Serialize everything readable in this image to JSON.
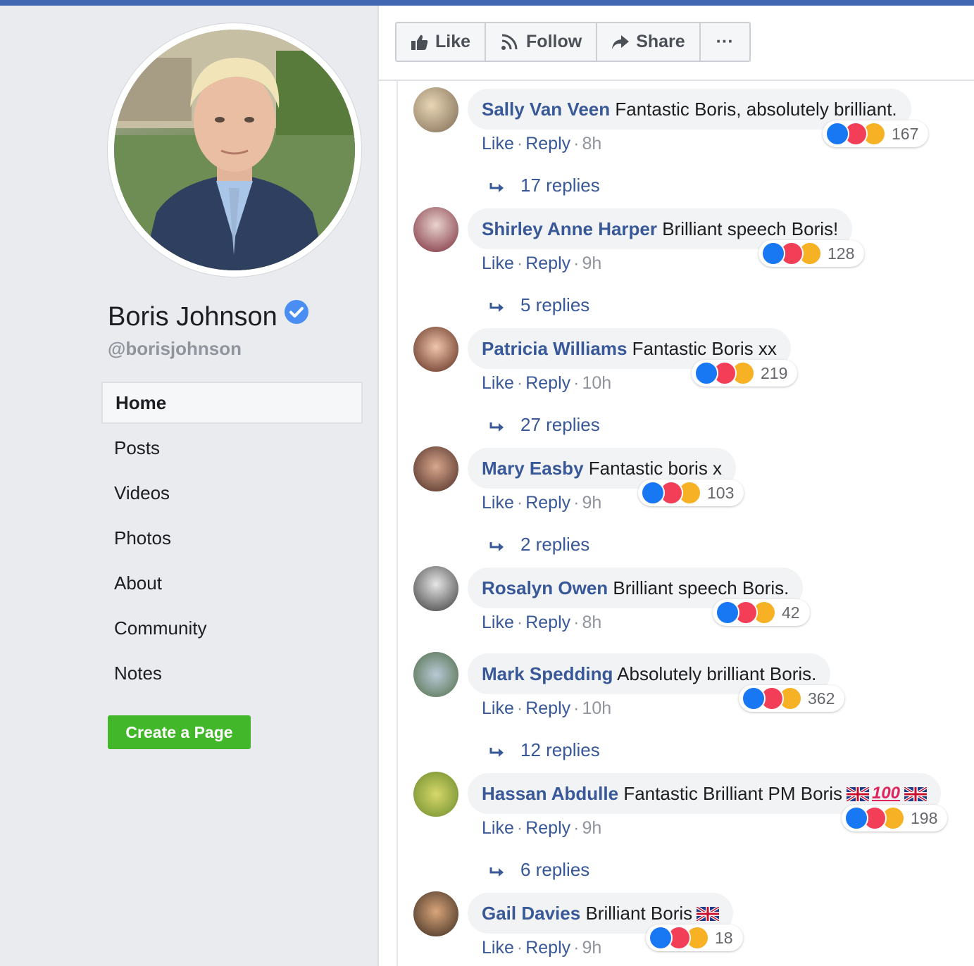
{
  "page": {
    "name": "Boris Johnson",
    "handle": "@borisjohnson"
  },
  "nav": [
    {
      "label": "Home"
    },
    {
      "label": "Posts"
    },
    {
      "label": "Videos"
    },
    {
      "label": "Photos"
    },
    {
      "label": "About"
    },
    {
      "label": "Community"
    },
    {
      "label": "Notes"
    }
  ],
  "create_page_label": "Create a Page",
  "actions": {
    "like": "Like",
    "follow": "Follow",
    "share": "Share",
    "more": "···"
  },
  "comment_labels": {
    "like": "Like",
    "reply": "Reply",
    "separator": "·"
  },
  "comments": [
    {
      "author": "Sally Van Veen",
      "text": "Fantastic Boris, absolutely brilliant.",
      "time": "8h",
      "reactions": "167",
      "replies": "17 replies"
    },
    {
      "author": "Shirley Anne Harper",
      "text": "Brilliant speech Boris!",
      "time": "9h",
      "reactions": "128",
      "replies": "5 replies"
    },
    {
      "author": "Patricia Williams",
      "text": "Fantastic Boris xx",
      "time": "10h",
      "reactions": "219",
      "replies": "27 replies"
    },
    {
      "author": "Mary Easby",
      "text": "Fantastic boris x",
      "time": "9h",
      "reactions": "103",
      "replies": "2 replies"
    },
    {
      "author": "Rosalyn Owen",
      "text": "Brilliant speech Boris.",
      "time": "8h",
      "reactions": "42",
      "replies": ""
    },
    {
      "author": "Mark Spedding",
      "text": "Absolutely brilliant Boris.",
      "time": "10h",
      "reactions": "362",
      "replies": "12 replies"
    },
    {
      "author": "Hassan Abdulle",
      "text": "Fantastic Brilliant PM Boris",
      "emoji_100": "100",
      "time": "9h",
      "reactions": "198",
      "replies": "6 replies"
    },
    {
      "author": "Gail Davies",
      "text": "Brilliant Boris",
      "time": "9h",
      "reactions": "18",
      "replies": ""
    }
  ],
  "colors": {
    "brand": "#4267b2",
    "link": "#385898",
    "create_button": "#42b72a",
    "verified": "#4a8ef3"
  }
}
